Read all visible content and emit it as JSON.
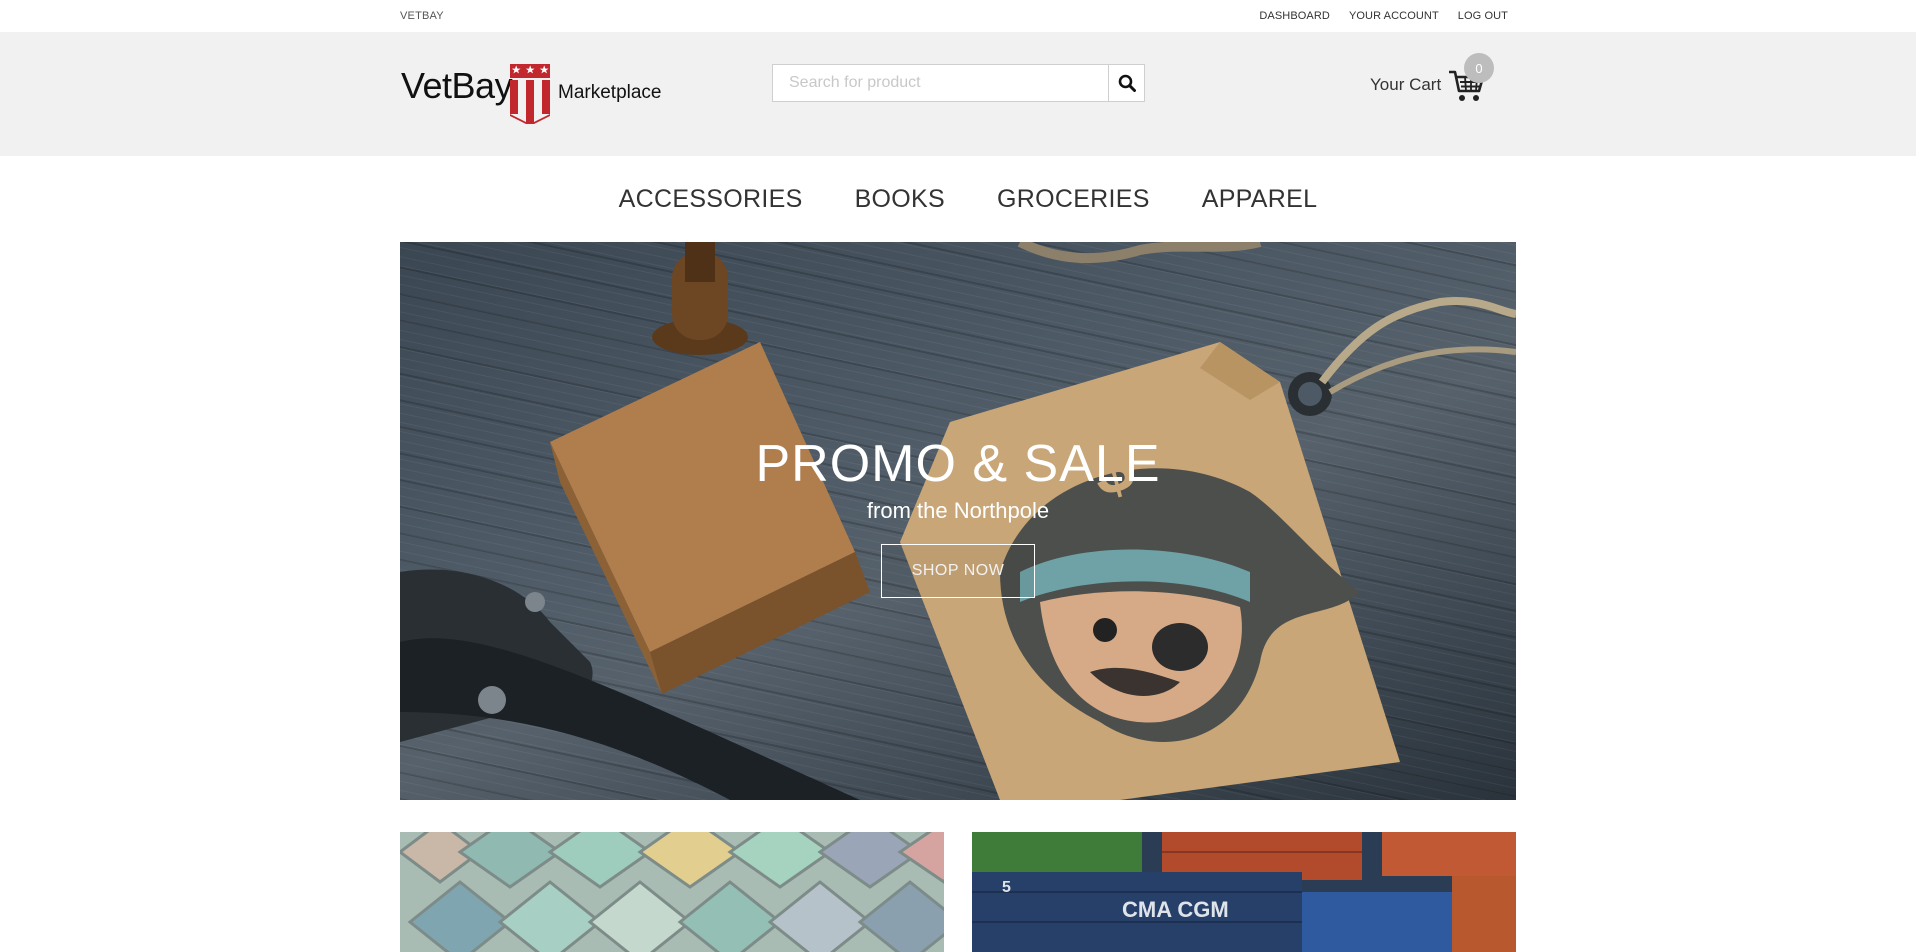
{
  "topbar": {
    "brand": "VETBAY",
    "links": [
      "DASHBOARD",
      "YOUR ACCOUNT",
      "LOG OUT"
    ]
  },
  "header": {
    "logo": {
      "name": "VetBay",
      "tagline": "Marketplace"
    },
    "search": {
      "placeholder": "Search for product",
      "value": "",
      "icon": "search-icon"
    },
    "cart": {
      "label": "Your Cart",
      "count": "0",
      "icon": "shopping-cart-icon"
    }
  },
  "nav": {
    "categories": [
      "ACCESSORIES",
      "BOOKS",
      "GROCERIES",
      "APPAREL"
    ]
  },
  "hero": {
    "title": "PROMO & SALE",
    "subtitle": "from the Northpole",
    "button": "SHOP NOW"
  },
  "colors": {
    "header_bg": "#f1f1f1",
    "logo_red": "#c1272d",
    "logo_star": "#ffffff",
    "badge_bg": "#bdbdbd"
  }
}
